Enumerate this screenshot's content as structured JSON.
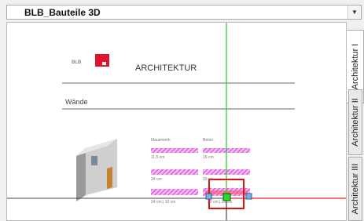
{
  "dropdown": {
    "label": "BLB_Bauteile 3D"
  },
  "tabs": [
    {
      "label": "Architektur I",
      "active": true
    },
    {
      "label": "Architektur II",
      "active": false
    },
    {
      "label": "Architektur III",
      "active": false
    }
  ],
  "sheet": {
    "logo_text": "BLB",
    "title": "ARCHITEKTUR",
    "section": "Wände",
    "columns": [
      "Mauerwerk",
      "Beton"
    ],
    "rows": [
      [
        "11,5 cm",
        "15 cm"
      ],
      [
        "24 cm",
        "20 cm"
      ],
      [
        "24 cm | 10 cm",
        "20 cm | 20 cm"
      ]
    ]
  },
  "colors": {
    "logo_red": "#e0142d",
    "hatch_magenta": "#e040e0",
    "axis_green": "#22cc22",
    "axis_red": "#ee2222",
    "selection_red": "#e01010"
  },
  "icons": {
    "dropdown_arrow": "chevron-down-icon",
    "gizmo": "move-gizmo-icon"
  }
}
